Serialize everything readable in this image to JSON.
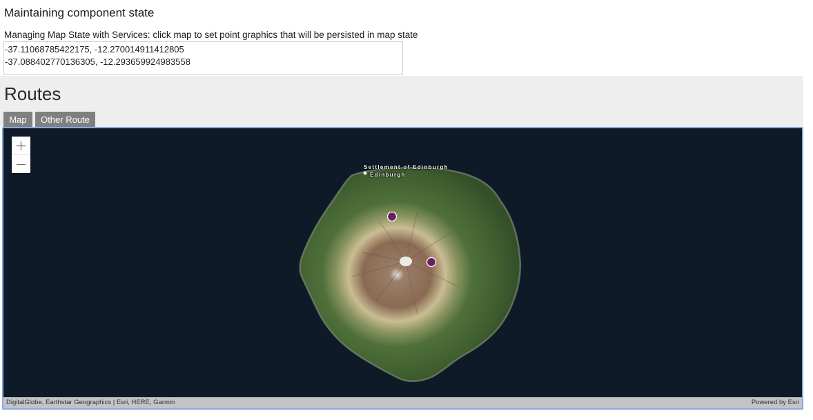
{
  "page": {
    "heading": "Maintaining component state",
    "intro": "Managing Map State with Services: click map to set point graphics that will be persisted in map state"
  },
  "coordinates": [
    "-37.11068785422175, -12.270014911412805",
    "-37.088402770136305, -12.293659924983558"
  ],
  "routes": {
    "title": "Routes",
    "tabs": [
      {
        "label": "Map",
        "active": true
      },
      {
        "label": "Other Route",
        "active": false
      }
    ]
  },
  "map": {
    "zoom_in_icon": "plus-icon",
    "zoom_out_icon": "minus-icon",
    "labels": {
      "settlement": "Settlement of Edinburgh",
      "town": "Edinburgh"
    },
    "point_color": "#6b1f63",
    "attribution": "DigitalGlobe, Earthstar Geographics | Esri, HERE, Garmin",
    "powered_by": "Powered by Esri"
  }
}
